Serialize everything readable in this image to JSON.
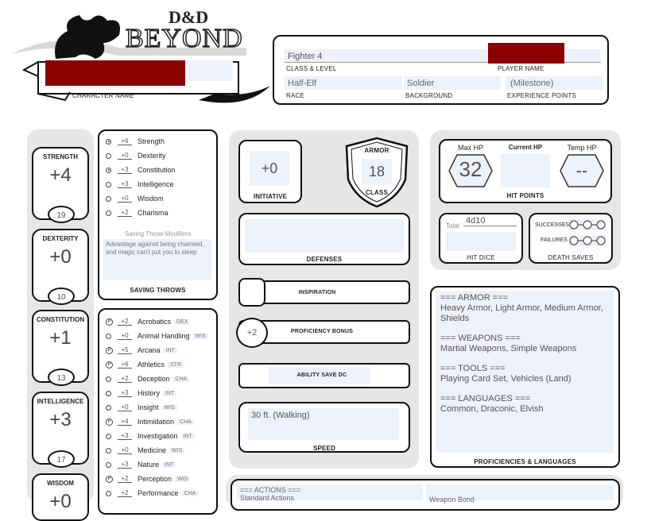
{
  "header": {
    "logo_dnd": "D&D",
    "logo_beyond": "BEYOND",
    "character_name_label": "CHARACTER NAME",
    "class_level_value": "Fighter 4",
    "class_level_label": "CLASS & LEVEL",
    "player_name_label": "PLAYER NAME",
    "race_value": "Half-Elf",
    "race_label": "RACE",
    "background_value": "Soldier",
    "background_label": "BACKGROUND",
    "xp_value": "(Milestone)",
    "xp_label": "EXPERIENCE POINTS",
    "redaction_color": "#8b0000"
  },
  "abilities": [
    {
      "name": "STRENGTH",
      "mod": "+4",
      "score": "19"
    },
    {
      "name": "DEXTERITY",
      "mod": "+0",
      "score": "10"
    },
    {
      "name": "CONSTITUTION",
      "mod": "+1",
      "score": "13"
    },
    {
      "name": "INTELLIGENCE",
      "mod": "+3",
      "score": "17"
    },
    {
      "name": "WISDOM",
      "mod": "+0"
    }
  ],
  "saving_throws": {
    "items": [
      {
        "mod": "+6",
        "name": "Strength",
        "proficient": true
      },
      {
        "mod": "+0",
        "name": "Dexterity",
        "proficient": false
      },
      {
        "mod": "+3",
        "name": "Constitution",
        "proficient": true
      },
      {
        "mod": "+3",
        "name": "Intelligence",
        "proficient": false
      },
      {
        "mod": "+0",
        "name": "Wisdom",
        "proficient": false
      },
      {
        "mod": "+2",
        "name": "Charisma",
        "proficient": false
      }
    ],
    "modifiers_title": "Saving Throw Modifiers",
    "modifiers_text": "Advantage against being charmed, and magic can't put you to sleep",
    "label": "SAVING THROWS"
  },
  "skills": [
    {
      "mod": "+2",
      "name": "Acrobatics",
      "attr": "DEX",
      "proficient": true
    },
    {
      "mod": "+0",
      "name": "Animal Handling",
      "attr": "WIS",
      "proficient": false
    },
    {
      "mod": "+5",
      "name": "Arcana",
      "attr": "INT",
      "proficient": true
    },
    {
      "mod": "+6",
      "name": "Athletics",
      "attr": "STR",
      "proficient": true
    },
    {
      "mod": "+2",
      "name": "Deception",
      "attr": "CHA",
      "proficient": false
    },
    {
      "mod": "+3",
      "name": "History",
      "attr": "INT",
      "proficient": false
    },
    {
      "mod": "+0",
      "name": "Insight",
      "attr": "WIS",
      "proficient": false
    },
    {
      "mod": "+4",
      "name": "Intimidation",
      "attr": "CHA",
      "proficient": true
    },
    {
      "mod": "+3",
      "name": "Investigation",
      "attr": "INT",
      "proficient": false
    },
    {
      "mod": "+0",
      "name": "Medicine",
      "attr": "WIS",
      "proficient": false
    },
    {
      "mod": "+3",
      "name": "Nature",
      "attr": "INT",
      "proficient": false
    },
    {
      "mod": "+2",
      "name": "Perception",
      "attr": "WIS",
      "proficient": true
    },
    {
      "mod": "+2",
      "name": "Performance",
      "attr": "CHA",
      "proficient": false
    }
  ],
  "combat": {
    "initiative_value": "+0",
    "initiative_label": "INITIATIVE",
    "armor_top": "ARMOR",
    "armor_value": "18",
    "armor_bottom": "CLASS",
    "defenses_label": "DEFENSES",
    "inspiration_label": "INSPIRATION",
    "proficiency_value": "+2",
    "proficiency_label": "PROFICIENCY BONUS",
    "save_dc_label": "ABILITY SAVE DC",
    "speed_value": "30 ft. (Walking)",
    "speed_label": "SPEED"
  },
  "hp": {
    "max_label": "Max HP",
    "max_value": "32",
    "current_label": "Current HP",
    "temp_label": "Temp HP",
    "temp_value": "--",
    "section_label": "HIT POINTS",
    "total_label": "Total",
    "hit_dice_value": "4d10",
    "hit_dice_label": "HIT DICE",
    "successes_label": "SUCCESSES",
    "failures_label": "FAILURES",
    "death_saves_label": "DEATH SAVES"
  },
  "proficiencies": {
    "armor_head": "=== ARMOR ===",
    "armor": "Heavy Armor, Light Armor, Medium Armor, Shields",
    "weapons_head": "=== WEAPONS ===",
    "weapons": "Martial Weapons, Simple Weapons",
    "tools_head": "=== TOOLS ===",
    "tools": "Playing Card Set, Vehicles (Land)",
    "languages_head": "=== LANGUAGES ===",
    "languages": "Common, Draconic, Elvish",
    "label": "PROFICIENCIES & LANGUAGES"
  },
  "actions": {
    "head": "=== ACTIONS ===",
    "sub": "Standard Actions",
    "weapon_bond": "Weapon Bond"
  }
}
